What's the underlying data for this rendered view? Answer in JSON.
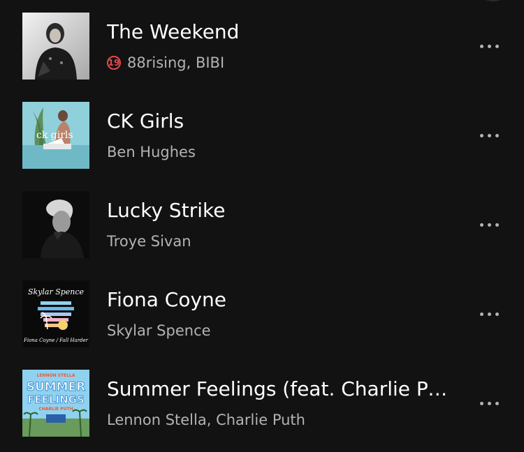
{
  "tracks": [
    {
      "title": "The Weekend",
      "artist": "88rising, BIBI",
      "explicit_badge": "19",
      "more_icon": "more-horizontal-icon"
    },
    {
      "title": "CK Girls",
      "artist": "Ben Hughes",
      "art_text": "ck girls",
      "more_icon": "more-horizontal-icon"
    },
    {
      "title": "Lucky Strike",
      "artist": "Troye Sivan",
      "more_icon": "more-horizontal-icon"
    },
    {
      "title": "Fiona Coyne",
      "artist": "Skylar Spence",
      "art_text_top": "Skylar Spence",
      "art_text_bottom": "Fiona Coyne / Fall Harder",
      "more_icon": "more-horizontal-icon"
    },
    {
      "title": "Summer Feelings (feat. Charlie Put…",
      "artist": "Lennon Stella, Charlie Puth",
      "art_text_top": "LENNON STELLA",
      "art_text_1": "SUMMER",
      "art_text_2": "FEELINGS",
      "art_text_3": "CHARLIE PUTH",
      "more_icon": "more-horizontal-icon"
    }
  ],
  "colors": {
    "background": "#121212",
    "title": "#ffffff",
    "subtitle": "#b3b3b3",
    "explicit_badge": "#e5484d"
  }
}
